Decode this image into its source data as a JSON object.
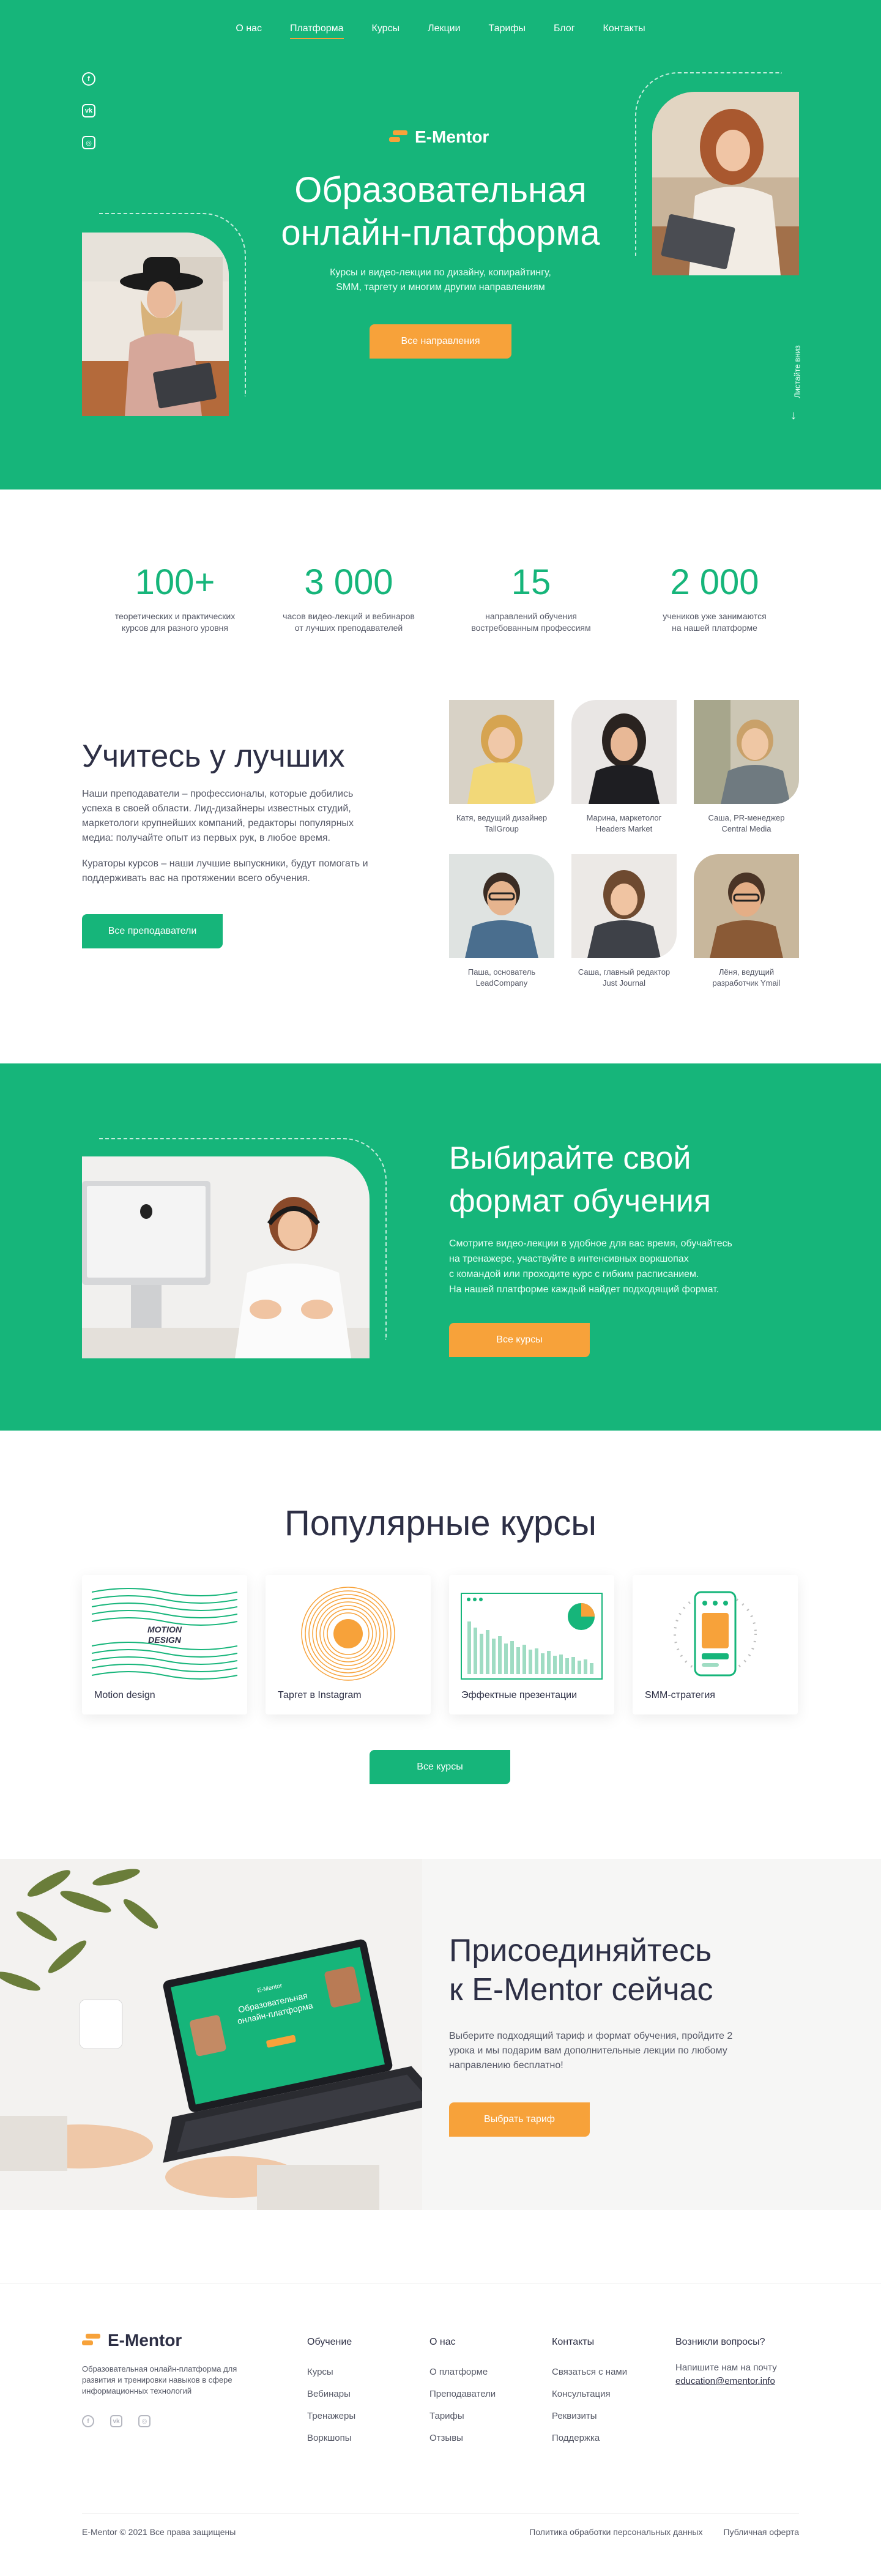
{
  "nav": {
    "items": [
      {
        "label": "О нас"
      },
      {
        "label": "Платформа"
      },
      {
        "label": "Курсы"
      },
      {
        "label": "Лекции"
      },
      {
        "label": "Тарифы"
      },
      {
        "label": "Блог"
      },
      {
        "label": "Контакты"
      }
    ],
    "active": "Платформа"
  },
  "brand": {
    "name": "E-Mentor",
    "accent": "#16b57a",
    "orange": "#f7a23a"
  },
  "hero": {
    "title_line1": "Образовательная",
    "title_line2": "онлайн-платформа",
    "lead_line1": "Курсы и видео-лекции по дизайну, копирайтингу,",
    "lead_line2": "SMM, таргету и многим другим направлениям",
    "cta": "Все направления",
    "scroll_hint": "Листайте вниз"
  },
  "stats": [
    {
      "num": "100+",
      "cap1": "теоретических и практических",
      "cap2": "курсов для разного уровня"
    },
    {
      "num": "3 000",
      "cap1": "часов видео-лекций и вебинаров",
      "cap2": "от лучших преподавателей"
    },
    {
      "num": "15",
      "cap1": "направлений обучения",
      "cap2": "востребованным профессиям"
    },
    {
      "num": "2 000",
      "cap1": "учеников уже занимаются",
      "cap2": "на нашей платформе"
    }
  ],
  "teachers": {
    "title": "Учитесь у лучших",
    "p1": "Наши преподаватели – профессионалы, которые добились успеха в своей области. Лид-дизайнеры известных студий, маркетологи крупнейших компаний, редакторы популярных медиа: получайте опыт из первых рук, в любое время.",
    "p2": "Кураторы курсов – наши лучшие выпускники, будут помогать и поддерживать вас на протяжении всего обучения.",
    "cta": "Все преподаватели",
    "people": [
      {
        "l1": "Катя, ведущий дизайнер",
        "l2": "TallGroup"
      },
      {
        "l1": "Марина, маркетолог",
        "l2": "Headers Market"
      },
      {
        "l1": "Саша, PR-менеджер",
        "l2": "Central Media"
      },
      {
        "l1": "Паша, основатель",
        "l2": "LeadCompany"
      },
      {
        "l1": "Саша, главный редактор",
        "l2": "Just Journal"
      },
      {
        "l1": "Лёня, ведущий",
        "l2": "разработчик Ymail"
      }
    ]
  },
  "format": {
    "title_line1": "Выбирайте свой",
    "title_line2": "формат обучения",
    "p_line1": "Смотрите видео-лекции в удобное для вас время, обучайтесь",
    "p_line2": "на тренажере, участвуйте в интенсивных воркшопах",
    "p_line3": "с командой или проходите курс с гибким расписанием.",
    "p_line4": "На нашей платформе каждый найдет подходящий формат.",
    "cta": "Все курсы"
  },
  "courses": {
    "title": "Популярные курсы",
    "items": [
      {
        "label": "Motion design",
        "thumb_text1": "MOTION",
        "thumb_text2": "DESIGN"
      },
      {
        "label": "Таргет в Instagram"
      },
      {
        "label": "Эффектные презентации"
      },
      {
        "label": "SMM-стратегия"
      }
    ],
    "cta": "Все курсы"
  },
  "join": {
    "title_line1": "Присоединяйтесь",
    "title_line2": "к E-Mentor сейчас",
    "p": "Выберите подходящий тариф и формат обучения, пройдите 2 урока и мы подарим вам дополнительные лекции по любому направлению бесплатно!",
    "cta": "Выбрать тариф",
    "screen_brand": "E-Mentor",
    "screen_title1": "Образовательная",
    "screen_title2": "онлайн-платформа"
  },
  "footer": {
    "brand": "E-Mentor",
    "desc": "Образовательная онлайн-платформа для развития и тренировки навыков в сфере информационных технологий",
    "col1": {
      "title": "Обучение",
      "links": [
        "Курсы",
        "Вебинары",
        "Тренажеры",
        "Воркшопы"
      ]
    },
    "col2": {
      "title": "О нас",
      "links": [
        "О платформе",
        "Преподаватели",
        "Тарифы",
        "Отзывы"
      ]
    },
    "col3": {
      "title": "Контакты",
      "links": [
        "Связаться с нами",
        "Консультация",
        "Реквизиты",
        "Поддержка"
      ]
    },
    "col4": {
      "title": "Возникли вопросы?",
      "p1": "Напишите нам на почту",
      "email": "education@ementor.info"
    },
    "copyright": "E-Mentor © 2021 Все права защищены",
    "privacy": "Политика обработки персональных данных",
    "offer": "Публичная оферта"
  },
  "icons": [
    "facebook-icon",
    "vk-icon",
    "instagram-icon",
    "arrow-down-icon",
    "logo-mark-icon"
  ]
}
